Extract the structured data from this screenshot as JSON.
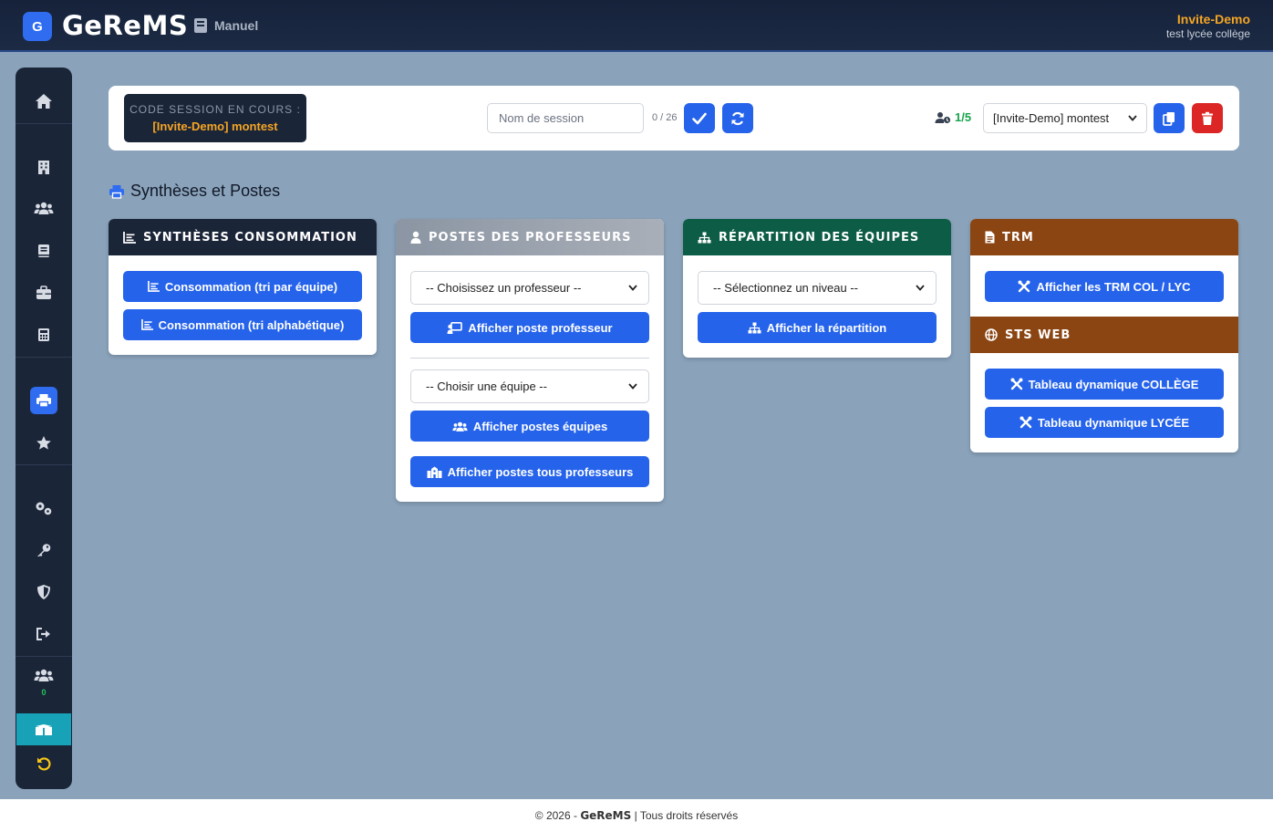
{
  "header": {
    "logo_letter": "G",
    "brand": "GeReMS",
    "manual_label": "Manuel",
    "user_name": "Invite-Demo",
    "user_sub": "test lycée collège"
  },
  "sidebar": {
    "icons": [
      "home-icon",
      "building-icon",
      "users-icon",
      "book-icon",
      "briefcase-icon",
      "calculator-icon",
      "print-icon",
      "star-icon",
      "cogs-icon",
      "key-icon",
      "shield-icon",
      "logout-icon",
      "users-online-icon",
      "box-icon",
      "undo-icon"
    ],
    "online_count": "0"
  },
  "session": {
    "code_label": "CODE SESSION EN COURS :",
    "code_value": "[Invite-Demo] montest",
    "name_placeholder": "Nom de session",
    "char_counter": "0 / 26",
    "users_count": "1/5",
    "selected_session": "[Invite-Demo] montest"
  },
  "section": {
    "title": "Synthèses et Postes"
  },
  "cards": {
    "consommation": {
      "title": "SYNTHÈSES CONSOMMATION",
      "btn_equipe": "Consommation (tri par équipe)",
      "btn_alpha": "Consommation (tri alphabétique)"
    },
    "professeurs": {
      "title": "POSTES DES PROFESSEURS",
      "select_prof": "-- Choisissez un professeur --",
      "btn_poste": "Afficher poste professeur",
      "select_equipe": "-- Choisir une équipe --",
      "btn_postes_equipes": "Afficher postes équipes",
      "btn_tous": "Afficher postes tous professeurs"
    },
    "repartition": {
      "title": "RÉPARTITION DES ÉQUIPES",
      "select_niveau": "-- Sélectionnez un niveau --",
      "btn_repartition": "Afficher la répartition"
    },
    "trm": {
      "title": "TRM",
      "btn_trm": "Afficher les TRM COL / LYC"
    },
    "sts": {
      "title": "STS WEB",
      "btn_college": "Tableau dynamique COLLÈGE",
      "btn_lycee": "Tableau dynamique LYCÉE"
    }
  },
  "footer": {
    "prefix": "© 2026 -",
    "brand": "GeReMS",
    "suffix": "| Tous droits réservés"
  },
  "colors": {
    "primary": "#2563eb",
    "danger": "#dc2626",
    "dark": "#1b2538",
    "green": "#0d5c45",
    "brown": "#8b4513",
    "gray_gradient_start": "#8b95a3",
    "accent_orange": "#f5a524",
    "background": "#8aa3bb"
  }
}
